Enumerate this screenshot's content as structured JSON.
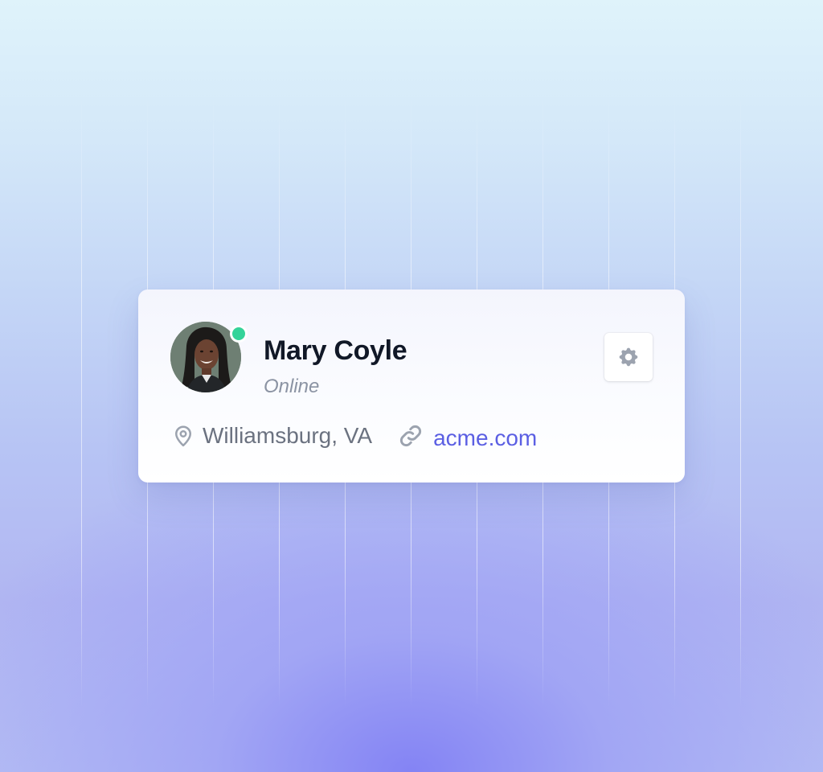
{
  "profile": {
    "name": "Mary Coyle",
    "status": "Online",
    "location": "Williamsburg, VA",
    "website": "acme.com"
  },
  "icons": {
    "settings": "gear-icon",
    "location": "map-pin-icon",
    "website": "link-icon"
  },
  "colors": {
    "status_online": "#34d399",
    "link": "#5b5fe3",
    "name": "#111827",
    "muted": "#6b7280",
    "icon": "#9ca3af"
  }
}
